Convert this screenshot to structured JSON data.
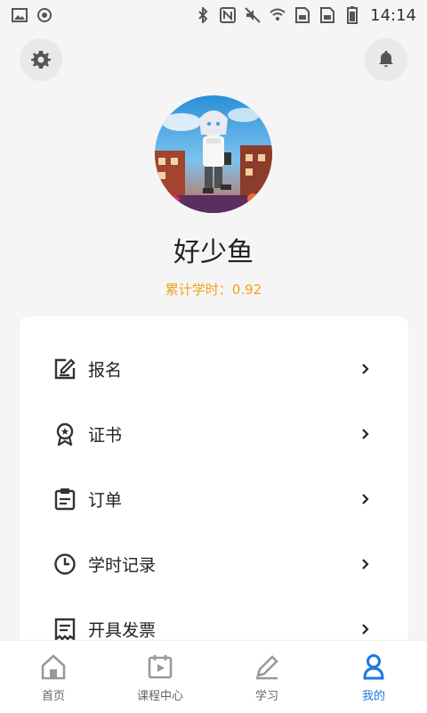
{
  "status_bar": {
    "time": "14:14",
    "left_icons": [
      "image-icon",
      "sync-icon"
    ],
    "right_icons": [
      "bluetooth-icon",
      "nfc-icon",
      "mute-icon",
      "wifi-icon",
      "sim-icon",
      "sim-icon",
      "battery-icon"
    ]
  },
  "header": {
    "settings_icon": "gear-icon",
    "notification_icon": "bell-icon"
  },
  "profile": {
    "username": "好少鱼",
    "study_hours": "累计学时：0.92"
  },
  "menu": {
    "items": [
      {
        "label": "报名",
        "icon": "edit-form-icon"
      },
      {
        "label": "证书",
        "icon": "certificate-badge-icon"
      },
      {
        "label": "订单",
        "icon": "clipboard-icon"
      },
      {
        "label": "学时记录",
        "icon": "clock-icon"
      },
      {
        "label": "开具发票",
        "icon": "invoice-icon"
      }
    ]
  },
  "bottom_nav": {
    "items": [
      {
        "label": "首页",
        "icon": "home-icon",
        "active": false
      },
      {
        "label": "课程中心",
        "icon": "video-calendar-icon",
        "active": false
      },
      {
        "label": "学习",
        "icon": "pencil-icon",
        "active": false
      },
      {
        "label": "我的",
        "icon": "person-icon",
        "active": true
      }
    ]
  },
  "colors": {
    "accent": "#1e78e0",
    "study_hours": "#f0a21b",
    "background": "#f5f5f5",
    "card": "#ffffff"
  }
}
